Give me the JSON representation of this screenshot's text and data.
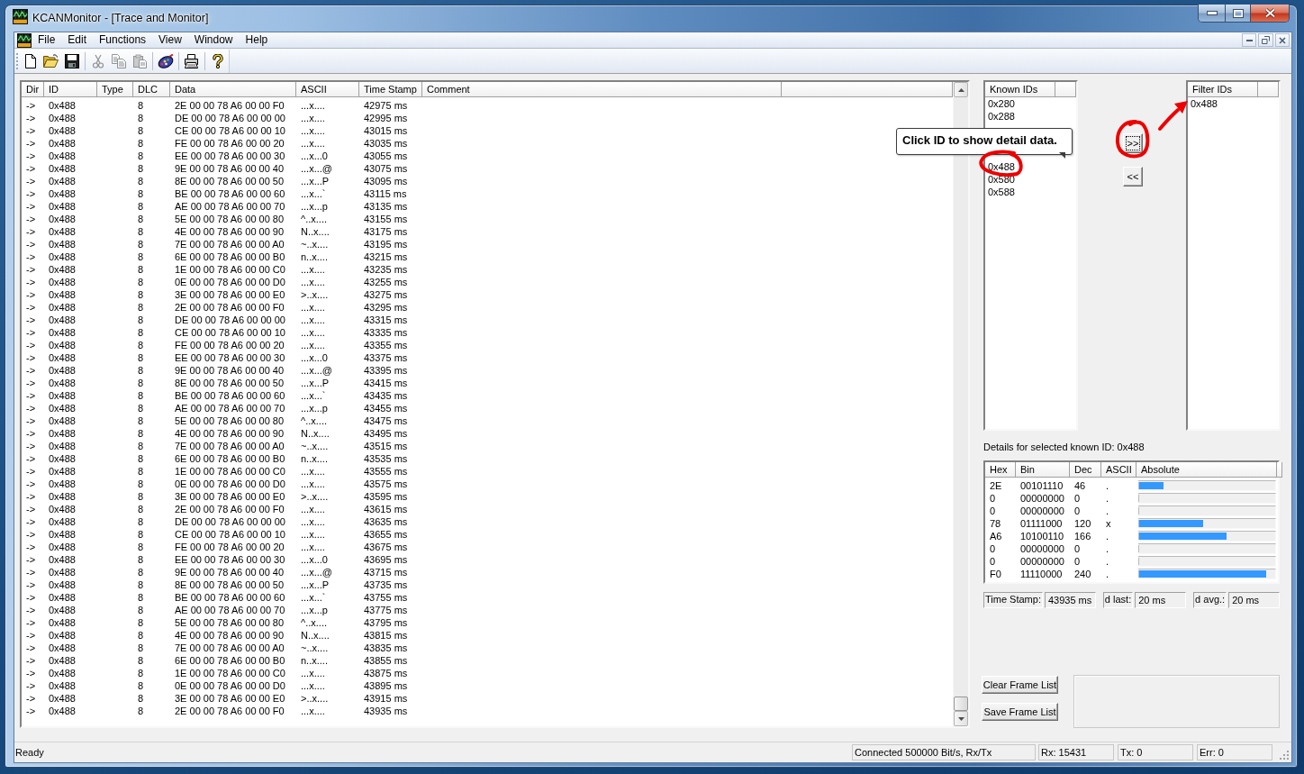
{
  "window": {
    "title": "KCANMonitor - [Trace and Monitor]"
  },
  "menu": [
    "File",
    "Edit",
    "Functions",
    "View",
    "Window",
    "Help"
  ],
  "toolbar": [
    [
      {
        "kind": "new",
        "disabled": false
      },
      {
        "kind": "open",
        "disabled": false
      },
      {
        "kind": "save",
        "disabled": false
      }
    ],
    [
      {
        "kind": "cut",
        "disabled": true
      },
      {
        "kind": "copy",
        "disabled": true
      },
      {
        "kind": "paste",
        "disabled": true
      }
    ],
    [
      {
        "kind": "connect",
        "disabled": false
      }
    ],
    [
      {
        "kind": "print",
        "disabled": false
      }
    ],
    [
      {
        "kind": "help",
        "disabled": false
      }
    ]
  ],
  "frame_list": {
    "columns": [
      "Dir",
      "ID",
      "Type",
      "DLC",
      "Data",
      "ASCII",
      "Time Stamp",
      "Comment"
    ],
    "rows": [
      {
        "dir": "->",
        "id": "0x488",
        "dlc": "8",
        "data": "2E 00 00 78 A6 00 00 F0",
        "ascii": "...x....",
        "time": "42975 ms"
      },
      {
        "dir": "->",
        "id": "0x488",
        "dlc": "8",
        "data": "DE 00 00 78 A6 00 00 00",
        "ascii": "...x....",
        "time": "42995 ms"
      },
      {
        "dir": "->",
        "id": "0x488",
        "dlc": "8",
        "data": "CE 00 00 78 A6 00 00 10",
        "ascii": "...x....",
        "time": "43015 ms"
      },
      {
        "dir": "->",
        "id": "0x488",
        "dlc": "8",
        "data": "FE 00 00 78 A6 00 00 20",
        "ascii": "...x....",
        "time": "43035 ms"
      },
      {
        "dir": "->",
        "id": "0x488",
        "dlc": "8",
        "data": "EE 00 00 78 A6 00 00 30",
        "ascii": "...x...0",
        "time": "43055 ms"
      },
      {
        "dir": "->",
        "id": "0x488",
        "dlc": "8",
        "data": "9E 00 00 78 A6 00 00 40",
        "ascii": "...x...@",
        "time": "43075 ms"
      },
      {
        "dir": "->",
        "id": "0x488",
        "dlc": "8",
        "data": "8E 00 00 78 A6 00 00 50",
        "ascii": "...x...P",
        "time": "43095 ms"
      },
      {
        "dir": "->",
        "id": "0x488",
        "dlc": "8",
        "data": "BE 00 00 78 A6 00 00 60",
        "ascii": "...x...`",
        "time": "43115 ms"
      },
      {
        "dir": "->",
        "id": "0x488",
        "dlc": "8",
        "data": "AE 00 00 78 A6 00 00 70",
        "ascii": "...x...p",
        "time": "43135 ms"
      },
      {
        "dir": "->",
        "id": "0x488",
        "dlc": "8",
        "data": "5E 00 00 78 A6 00 00 80",
        "ascii": "^..x....",
        "time": "43155 ms"
      },
      {
        "dir": "->",
        "id": "0x488",
        "dlc": "8",
        "data": "4E 00 00 78 A6 00 00 90",
        "ascii": "N..x....",
        "time": "43175 ms"
      },
      {
        "dir": "->",
        "id": "0x488",
        "dlc": "8",
        "data": "7E 00 00 78 A6 00 00 A0",
        "ascii": "~..x....",
        "time": "43195 ms"
      },
      {
        "dir": "->",
        "id": "0x488",
        "dlc": "8",
        "data": "6E 00 00 78 A6 00 00 B0",
        "ascii": "n..x....",
        "time": "43215 ms"
      },
      {
        "dir": "->",
        "id": "0x488",
        "dlc": "8",
        "data": "1E 00 00 78 A6 00 00 C0",
        "ascii": "...x....",
        "time": "43235 ms"
      },
      {
        "dir": "->",
        "id": "0x488",
        "dlc": "8",
        "data": "0E 00 00 78 A6 00 00 D0",
        "ascii": "...x....",
        "time": "43255 ms"
      },
      {
        "dir": "->",
        "id": "0x488",
        "dlc": "8",
        "data": "3E 00 00 78 A6 00 00 E0",
        "ascii": ">..x....",
        "time": "43275 ms"
      },
      {
        "dir": "->",
        "id": "0x488",
        "dlc": "8",
        "data": "2E 00 00 78 A6 00 00 F0",
        "ascii": "...x....",
        "time": "43295 ms"
      },
      {
        "dir": "->",
        "id": "0x488",
        "dlc": "8",
        "data": "DE 00 00 78 A6 00 00 00",
        "ascii": "...x....",
        "time": "43315 ms"
      },
      {
        "dir": "->",
        "id": "0x488",
        "dlc": "8",
        "data": "CE 00 00 78 A6 00 00 10",
        "ascii": "...x....",
        "time": "43335 ms"
      },
      {
        "dir": "->",
        "id": "0x488",
        "dlc": "8",
        "data": "FE 00 00 78 A6 00 00 20",
        "ascii": "...x....",
        "time": "43355 ms"
      },
      {
        "dir": "->",
        "id": "0x488",
        "dlc": "8",
        "data": "EE 00 00 78 A6 00 00 30",
        "ascii": "...x...0",
        "time": "43375 ms"
      },
      {
        "dir": "->",
        "id": "0x488",
        "dlc": "8",
        "data": "9E 00 00 78 A6 00 00 40",
        "ascii": "...x...@",
        "time": "43395 ms"
      },
      {
        "dir": "->",
        "id": "0x488",
        "dlc": "8",
        "data": "8E 00 00 78 A6 00 00 50",
        "ascii": "...x...P",
        "time": "43415 ms"
      },
      {
        "dir": "->",
        "id": "0x488",
        "dlc": "8",
        "data": "BE 00 00 78 A6 00 00 60",
        "ascii": "...x...`",
        "time": "43435 ms"
      },
      {
        "dir": "->",
        "id": "0x488",
        "dlc": "8",
        "data": "AE 00 00 78 A6 00 00 70",
        "ascii": "...x...p",
        "time": "43455 ms"
      },
      {
        "dir": "->",
        "id": "0x488",
        "dlc": "8",
        "data": "5E 00 00 78 A6 00 00 80",
        "ascii": "^..x....",
        "time": "43475 ms"
      },
      {
        "dir": "->",
        "id": "0x488",
        "dlc": "8",
        "data": "4E 00 00 78 A6 00 00 90",
        "ascii": "N..x....",
        "time": "43495 ms"
      },
      {
        "dir": "->",
        "id": "0x488",
        "dlc": "8",
        "data": "7E 00 00 78 A6 00 00 A0",
        "ascii": "~..x....",
        "time": "43515 ms"
      },
      {
        "dir": "->",
        "id": "0x488",
        "dlc": "8",
        "data": "6E 00 00 78 A6 00 00 B0",
        "ascii": "n..x....",
        "time": "43535 ms"
      },
      {
        "dir": "->",
        "id": "0x488",
        "dlc": "8",
        "data": "1E 00 00 78 A6 00 00 C0",
        "ascii": "...x....",
        "time": "43555 ms"
      },
      {
        "dir": "->",
        "id": "0x488",
        "dlc": "8",
        "data": "0E 00 00 78 A6 00 00 D0",
        "ascii": "...x....",
        "time": "43575 ms"
      },
      {
        "dir": "->",
        "id": "0x488",
        "dlc": "8",
        "data": "3E 00 00 78 A6 00 00 E0",
        "ascii": ">..x....",
        "time": "43595 ms"
      },
      {
        "dir": "->",
        "id": "0x488",
        "dlc": "8",
        "data": "2E 00 00 78 A6 00 00 F0",
        "ascii": "...x....",
        "time": "43615 ms"
      },
      {
        "dir": "->",
        "id": "0x488",
        "dlc": "8",
        "data": "DE 00 00 78 A6 00 00 00",
        "ascii": "...x....",
        "time": "43635 ms"
      },
      {
        "dir": "->",
        "id": "0x488",
        "dlc": "8",
        "data": "CE 00 00 78 A6 00 00 10",
        "ascii": "...x....",
        "time": "43655 ms"
      },
      {
        "dir": "->",
        "id": "0x488",
        "dlc": "8",
        "data": "FE 00 00 78 A6 00 00 20",
        "ascii": "...x....",
        "time": "43675 ms"
      },
      {
        "dir": "->",
        "id": "0x488",
        "dlc": "8",
        "data": "EE 00 00 78 A6 00 00 30",
        "ascii": "...x...0",
        "time": "43695 ms"
      },
      {
        "dir": "->",
        "id": "0x488",
        "dlc": "8",
        "data": "9E 00 00 78 A6 00 00 40",
        "ascii": "...x...@",
        "time": "43715 ms"
      },
      {
        "dir": "->",
        "id": "0x488",
        "dlc": "8",
        "data": "8E 00 00 78 A6 00 00 50",
        "ascii": "...x...P",
        "time": "43735 ms"
      },
      {
        "dir": "->",
        "id": "0x488",
        "dlc": "8",
        "data": "BE 00 00 78 A6 00 00 60",
        "ascii": "...x...`",
        "time": "43755 ms"
      },
      {
        "dir": "->",
        "id": "0x488",
        "dlc": "8",
        "data": "AE 00 00 78 A6 00 00 70",
        "ascii": "...x...p",
        "time": "43775 ms"
      },
      {
        "dir": "->",
        "id": "0x488",
        "dlc": "8",
        "data": "5E 00 00 78 A6 00 00 80",
        "ascii": "^..x....",
        "time": "43795 ms"
      },
      {
        "dir": "->",
        "id": "0x488",
        "dlc": "8",
        "data": "4E 00 00 78 A6 00 00 90",
        "ascii": "N..x....",
        "time": "43815 ms"
      },
      {
        "dir": "->",
        "id": "0x488",
        "dlc": "8",
        "data": "7E 00 00 78 A6 00 00 A0",
        "ascii": "~..x....",
        "time": "43835 ms"
      },
      {
        "dir": "->",
        "id": "0x488",
        "dlc": "8",
        "data": "6E 00 00 78 A6 00 00 B0",
        "ascii": "n..x....",
        "time": "43855 ms"
      },
      {
        "dir": "->",
        "id": "0x488",
        "dlc": "8",
        "data": "1E 00 00 78 A6 00 00 C0",
        "ascii": "...x....",
        "time": "43875 ms"
      },
      {
        "dir": "->",
        "id": "0x488",
        "dlc": "8",
        "data": "0E 00 00 78 A6 00 00 D0",
        "ascii": "...x....",
        "time": "43895 ms"
      },
      {
        "dir": "->",
        "id": "0x488",
        "dlc": "8",
        "data": "3E 00 00 78 A6 00 00 E0",
        "ascii": ">..x....",
        "time": "43915 ms"
      },
      {
        "dir": "->",
        "id": "0x488",
        "dlc": "8",
        "data": "2E 00 00 78 A6 00 00 F0",
        "ascii": "...x....",
        "time": "43935 ms"
      }
    ]
  },
  "known_ids": {
    "header": "Known IDs",
    "items": [
      {
        "kind": "id",
        "label": "0x280"
      },
      {
        "kind": "id",
        "label": "0x288"
      },
      {
        "kind": "covered"
      },
      {
        "kind": "covered"
      },
      {
        "kind": "covered"
      },
      {
        "kind": "id",
        "label": "0x488"
      },
      {
        "kind": "id",
        "label": "0x580"
      },
      {
        "kind": "id",
        "label": "0x588"
      }
    ]
  },
  "tooltip": "Click ID to show detail data.",
  "move_buttons": [
    {
      "label": ">>",
      "focused": true
    },
    {
      "label": "<<",
      "focused": false
    }
  ],
  "filter_ids": {
    "header": "Filter IDs",
    "items": [
      "0x488"
    ]
  },
  "details": {
    "label": "Details for selected known ID: 0x488",
    "columns": [
      "Hex",
      "Bin",
      "Dec",
      "ASCII",
      "Absolute"
    ],
    "rows": [
      {
        "hex": "2E",
        "bin": "00101110",
        "dec": "46",
        "ascii": ".",
        "level": 0.18
      },
      {
        "hex": "0",
        "bin": "00000000",
        "dec": "0",
        "ascii": ".",
        "level": 0
      },
      {
        "hex": "0",
        "bin": "00000000",
        "dec": "0",
        "ascii": ".",
        "level": 0
      },
      {
        "hex": "78",
        "bin": "01111000",
        "dec": "120",
        "ascii": "x",
        "level": 0.47
      },
      {
        "hex": "A6",
        "bin": "10100110",
        "dec": "166",
        "ascii": ".",
        "level": 0.65
      },
      {
        "hex": "0",
        "bin": "00000000",
        "dec": "0",
        "ascii": ".",
        "level": 0
      },
      {
        "hex": "0",
        "bin": "00000000",
        "dec": "0",
        "ascii": ".",
        "level": 0
      },
      {
        "hex": "F0",
        "bin": "11110000",
        "dec": "240",
        "ascii": ".",
        "level": 0.94
      }
    ]
  },
  "timing": [
    {
      "label": "Time Stamp:",
      "value": "43935 ms"
    },
    {
      "label": "d last:",
      "value": "20 ms"
    },
    {
      "label": "d avg.:",
      "value": "20 ms"
    }
  ],
  "buttons": [
    "Clear Frame List",
    "Save Frame List"
  ],
  "status_bar": {
    "message": "Ready",
    "panels": [
      "Connected 500000 Bit/s, Rx/Tx",
      "Rx: 15431",
      "Tx: 0",
      "Err: 0"
    ]
  }
}
